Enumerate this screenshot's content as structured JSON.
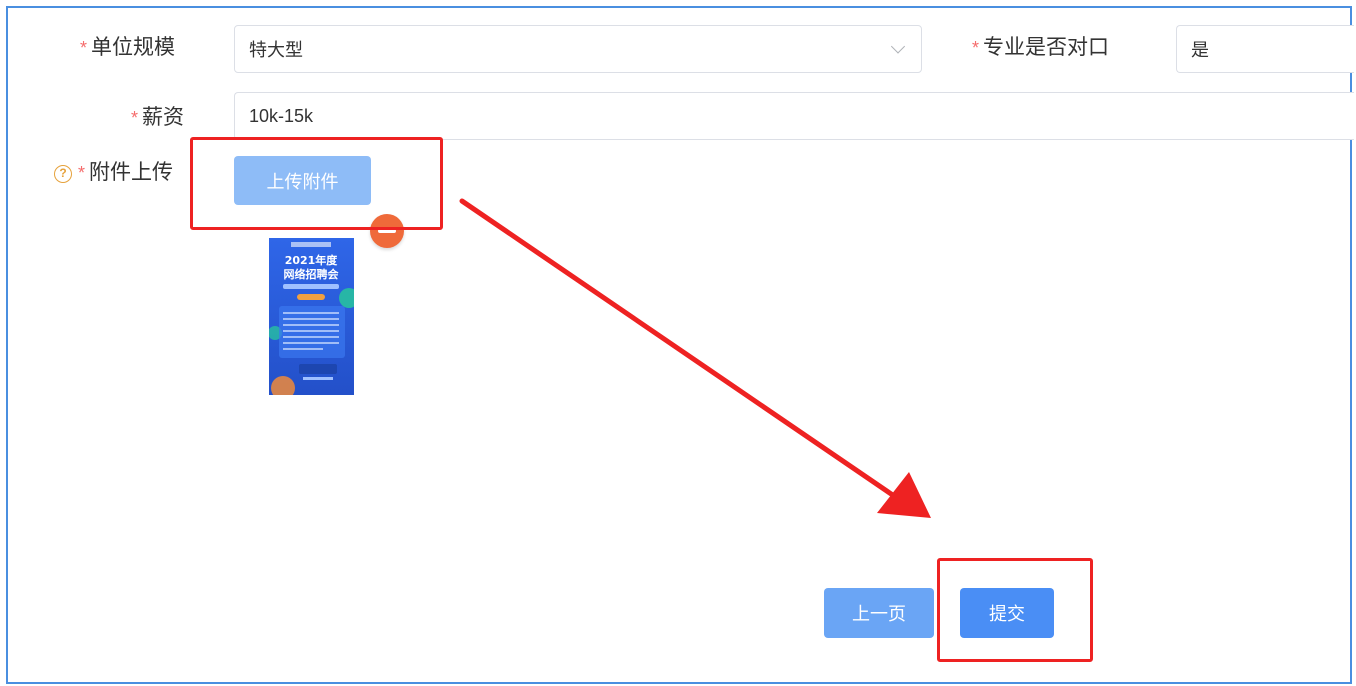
{
  "form": {
    "required_mark": "*",
    "unit_scale": {
      "label": "单位规模",
      "value": "特大型"
    },
    "major_match": {
      "label": "专业是否对口",
      "value": "是"
    },
    "salary": {
      "label": "薪资",
      "value": "10k-15k"
    },
    "attachment": {
      "label": "附件上传",
      "help_glyph": "?",
      "upload_button": "上传附件"
    },
    "attachment_thumbnail": {
      "title_line1": "2021年度",
      "title_line2": "网络招聘会"
    }
  },
  "actions": {
    "prev_button": "上一页",
    "submit_button": "提交"
  },
  "colors": {
    "frame_border": "#4a8fe0",
    "required_star": "#f56c6c",
    "upload_button": "#8ebcf7",
    "prev_button": "#6aa5f5",
    "submit_button": "#4a8ef5",
    "remove_icon": "#ef6a3a",
    "annotation": "#ee2222"
  },
  "icons": {
    "help": "question-circle-icon",
    "select_arrow": "chevron-down-icon",
    "remove": "minus-circle-icon"
  }
}
